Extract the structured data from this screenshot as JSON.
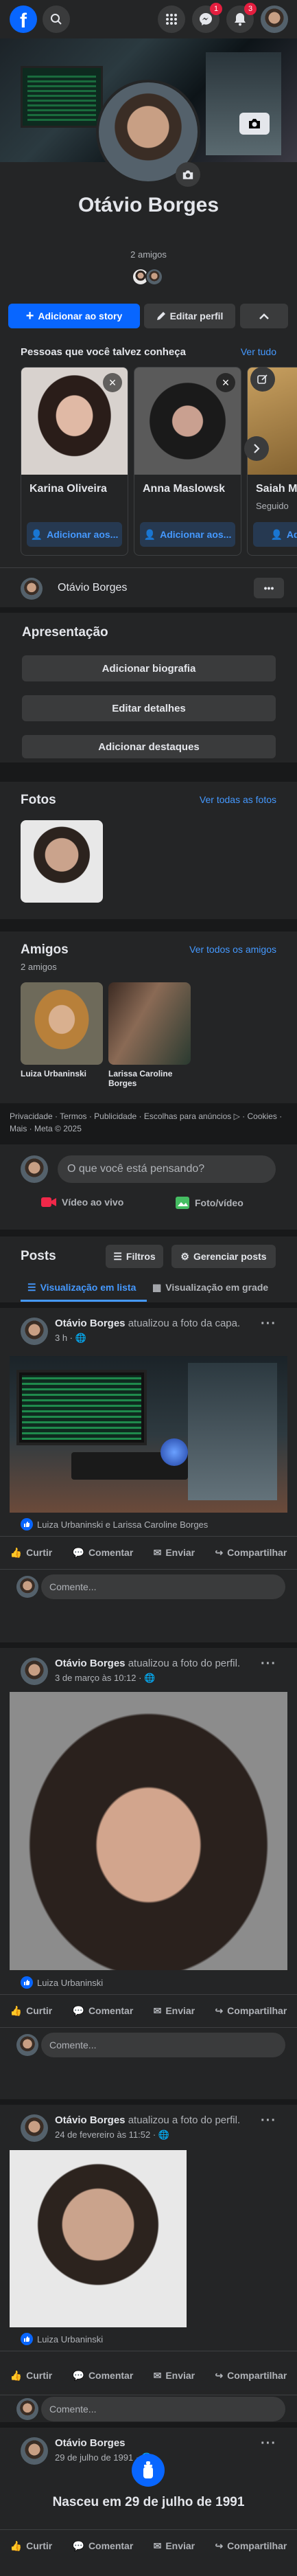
{
  "header": {
    "logo": "f",
    "icons": [
      "search-icon",
      "grid-menu-icon",
      "messenger-icon",
      "bell-icon"
    ],
    "messenger_badge": "1",
    "notifications_badge": "3"
  },
  "profile": {
    "name": "Otávio Borges",
    "friends_count": "2 amigos",
    "add_story_label": "Adicionar ao story",
    "edit_profile_label": "Editar perfil"
  },
  "suggestions": {
    "title": "Pessoas que você talvez conheça",
    "see_all": "Ver tudo",
    "people": [
      {
        "name": "Karina Oliveira",
        "action": "Adicionar aos..."
      },
      {
        "name": "Anna Maslowsk",
        "action": "Adicionar aos..."
      },
      {
        "name": "Saiah M",
        "subtitle": "Seguido",
        "action": "Adicionar"
      }
    ]
  },
  "profile_switch": {
    "name": "Otávio Borges"
  },
  "intro": {
    "title": "Apresentação",
    "buttons": [
      "Adicionar biografia",
      "Editar detalhes",
      "Adicionar destaques"
    ]
  },
  "photos": {
    "title": "Fotos",
    "see_all": "Ver todas as fotos"
  },
  "friends": {
    "title": "Amigos",
    "count": "2 amigos",
    "see_all": "Ver todos os amigos",
    "list": [
      {
        "name": "Luiza Urbaninski"
      },
      {
        "name": "Larissa Caroline Borges"
      }
    ]
  },
  "footer_links": "Privacidade · Termos · Publicidade · Escolhas para anúncios ▷ · Cookies · Mais · Meta © 2025",
  "composer": {
    "placeholder": "O que você está pensando?",
    "live_label": "Vídeo ao vivo",
    "photo_label": "Foto/vídeo"
  },
  "posts_section": {
    "title": "Posts",
    "filters_label": "Filtros",
    "manage_label": "Gerenciar posts",
    "list_view_label": "Visualização em lista",
    "grid_view_label": "Visualização em grade"
  },
  "post_actions": {
    "like": "Curtir",
    "comment": "Comentar",
    "send": "Enviar",
    "share": "Compartilhar",
    "comment_placeholder": "Comente..."
  },
  "posts": [
    {
      "author": "Otávio Borges",
      "action": " atualizou a foto da capa.",
      "time": "3 h · ",
      "reactions": "Luiza Urbaninski e Larissa Caroline Borges"
    },
    {
      "author": "Otávio Borges",
      "action": " atualizou a foto do perfil.",
      "time": "3 de março às 10:12 · ",
      "reactions": "Luiza Urbaninski"
    },
    {
      "author": "Otávio Borges",
      "action": " atualizou a foto do perfil.",
      "time": "24 de fevereiro às 11:52 · ",
      "reactions": "Luiza Urbaninski"
    },
    {
      "author": "Otávio Borges",
      "action": "",
      "time": "29 de julho de 1991 · ",
      "life_event": "Nasceu em 29 de julho de 1991"
    }
  ],
  "colors": {
    "accent": "#0866ff",
    "background": "#18191a",
    "card": "#242526",
    "link": "#4599ff"
  }
}
